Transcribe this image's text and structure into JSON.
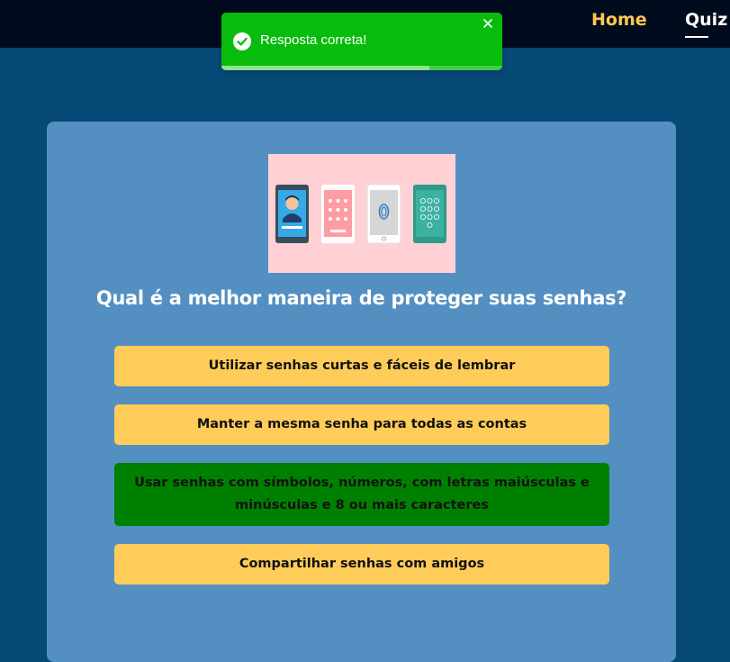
{
  "nav": {
    "home_label": "Home",
    "quiz_label": "Quiz"
  },
  "toast": {
    "message": "Resposta correta!",
    "icon": "check-circle-icon",
    "close_icon": "close-icon",
    "progress": 0.74,
    "color": "#07bc0c"
  },
  "quiz": {
    "image_icon": "smartphone-lock-screens-illustration",
    "question": "Qual é a melhor maneira de proteger suas senhas?",
    "answers": [
      {
        "label": "Utilizar senhas curtas e fáceis de lembrar",
        "state": "default"
      },
      {
        "label": "Manter a mesma senha para todas as contas",
        "state": "default"
      },
      {
        "label": "Usar senhas com símbolos, números, com letras maiúsculas e minúsculas e 8 ou mais caracteres",
        "state": "correct"
      },
      {
        "label": "Compartilhar senhas com amigos",
        "state": "default"
      }
    ]
  },
  "colors": {
    "background": "#074a78",
    "topbar": "#010b1e",
    "card": "#5390c1",
    "answer_default": "#ffcc59",
    "answer_correct": "#008000",
    "nav_home": "#ffc94f"
  }
}
